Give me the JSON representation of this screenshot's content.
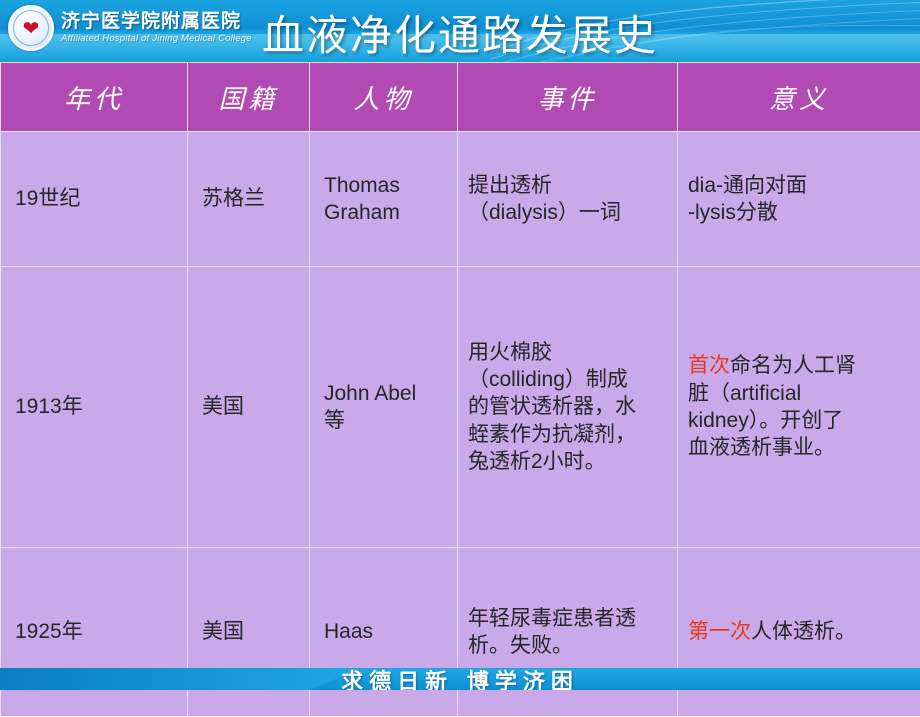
{
  "banner": {
    "org_name_cn": "济宁医学院附属医院",
    "org_name_en": "Affiliated Hospital of Jining Medical College",
    "logo_icon": "heart-shield-icon"
  },
  "slide": {
    "title": "血液净化通路发展史"
  },
  "table": {
    "headers": [
      "年代",
      "国籍",
      "人物",
      "事件",
      "意义"
    ],
    "rows": [
      {
        "year": "19世纪",
        "country": "苏格兰",
        "person_lines": [
          "Thomas",
          "Graham"
        ],
        "event_lines": [
          "提出透析",
          "（dialysis）一词"
        ],
        "meaning_lines": [
          "dia-通向对面",
          "-lysis分散"
        ],
        "meaning_highlight": ""
      },
      {
        "year": "1913年",
        "country": "美国",
        "person_lines": [
          "John Abel",
          "等"
        ],
        "event_lines": [
          "用火棉胶",
          "（colliding）制成",
          "的管状透析器，水",
          "蛭素作为抗凝剂，",
          "兔透析2小时。"
        ],
        "meaning_highlight": "首次",
        "meaning_lines": [
          "命名为人工肾",
          "脏（artificial",
          "kidney）。开创了",
          "血液透析事业。"
        ]
      },
      {
        "year": "1925年",
        "country": "美国",
        "person_lines": [
          "Haas"
        ],
        "event_lines": [
          "年轻尿毒症患者透",
          "析。失败。"
        ],
        "meaning_highlight": "第一次",
        "meaning_lines": [
          "人体透析。"
        ]
      }
    ]
  },
  "footer": {
    "slogan": "求德日新   博学济困"
  },
  "colors": {
    "banner_blue": "#13a0dd",
    "header_purple": "#b14bb3",
    "cell_purple": "#c9a9ea",
    "highlight_red": "#e8391c",
    "page_background": "#8f7fd4"
  }
}
